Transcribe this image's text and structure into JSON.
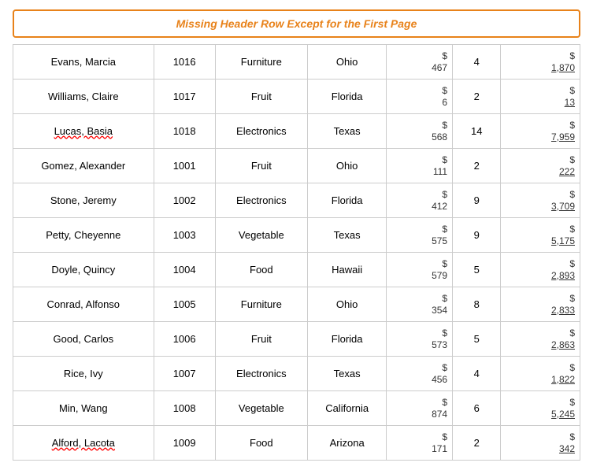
{
  "header": {
    "title": "Missing Header Row Except for the First Page"
  },
  "rows": [
    {
      "name": "Evans, Marcia",
      "id": "1016",
      "category": "Furniture",
      "state": "Ohio",
      "price": "467",
      "qty": "4",
      "total": "1,870"
    },
    {
      "name": "Williams, Claire",
      "id": "1017",
      "category": "Fruit",
      "state": "Florida",
      "price": "6",
      "qty": "2",
      "total": "13"
    },
    {
      "name": "Lucas, Basia",
      "id": "1018",
      "category": "Electronics",
      "state": "Texas",
      "price": "568",
      "qty": "14",
      "total": "7,959"
    },
    {
      "name": "Gomez, Alexander",
      "id": "1001",
      "category": "Fruit",
      "state": "Ohio",
      "price": "111",
      "qty": "2",
      "total": "222"
    },
    {
      "name": "Stone, Jeremy",
      "id": "1002",
      "category": "Electronics",
      "state": "Florida",
      "price": "412",
      "qty": "9",
      "total": "3,709"
    },
    {
      "name": "Petty, Cheyenne",
      "id": "1003",
      "category": "Vegetable",
      "state": "Texas",
      "price": "575",
      "qty": "9",
      "total": "5,175"
    },
    {
      "name": "Doyle, Quincy",
      "id": "1004",
      "category": "Food",
      "state": "Hawaii",
      "price": "579",
      "qty": "5",
      "total": "2,893"
    },
    {
      "name": "Conrad, Alfonso",
      "id": "1005",
      "category": "Furniture",
      "state": "Ohio",
      "price": "354",
      "qty": "8",
      "total": "2,833"
    },
    {
      "name": "Good, Carlos",
      "id": "1006",
      "category": "Fruit",
      "state": "Florida",
      "price": "573",
      "qty": "5",
      "total": "2,863"
    },
    {
      "name": "Rice, Ivy",
      "id": "1007",
      "category": "Electronics",
      "state": "Texas",
      "price": "456",
      "qty": "4",
      "total": "1,822"
    },
    {
      "name": "Min, Wang",
      "id": "1008",
      "category": "Vegetable",
      "state": "California",
      "price": "874",
      "qty": "6",
      "total": "5,245"
    },
    {
      "name": "Alford, Lacota",
      "id": "1009",
      "category": "Food",
      "state": "Arizona",
      "price": "171",
      "qty": "2",
      "total": "342"
    }
  ]
}
